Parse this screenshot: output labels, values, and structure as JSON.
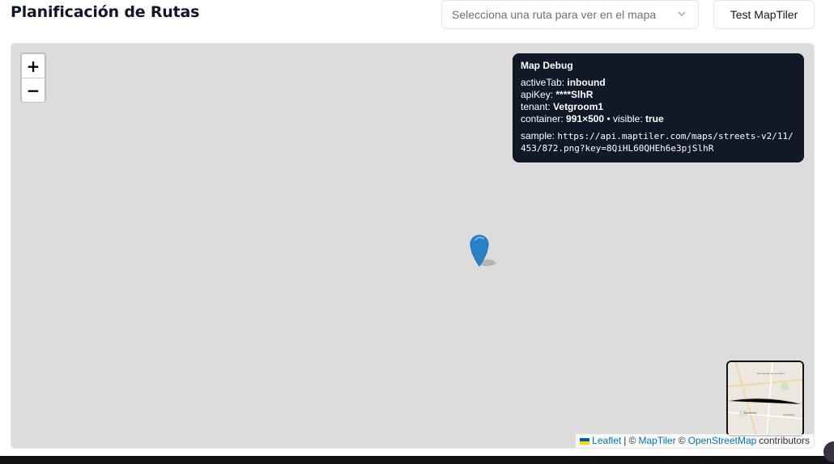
{
  "header": {
    "title": "Planificación de Rutas",
    "route_select_placeholder": "Selecciona una ruta para ver en el mapa",
    "test_button_label": "Test MapTiler"
  },
  "map": {
    "zoom_in_label": "+",
    "zoom_out_label": "−",
    "debug": {
      "title": "Map Debug",
      "active_tab_label": "activeTab:",
      "active_tab_value": "inbound",
      "api_key_label": "apiKey:",
      "api_key_value": "****SlhR",
      "tenant_label": "tenant:",
      "tenant_value": "Vetgroom1",
      "container_label": "container:",
      "container_value": "991×500",
      "visible_label": "• visible:",
      "visible_value": "true",
      "sample_label": "sample:",
      "sample_value": "https://api.maptiler.com/maps/streets-v2/11/453/872.png?key=8QiHL60QHEh6e3pjSlhR"
    },
    "minimap_labels": {
      "top": "San Nicolás de los Garza",
      "bottom": "Monterrey",
      "right": "Guadalupe"
    },
    "attribution": {
      "leaflet": "Leaflet",
      "separator": "| ©",
      "maptiler": "MapTiler",
      "copyright": "©",
      "osm": "OpenStreetMap",
      "contributors": "contributors"
    },
    "colors": {
      "map_background": "#dcdcdc",
      "marker": "#2a81cb",
      "debug_background": "#111827"
    }
  }
}
